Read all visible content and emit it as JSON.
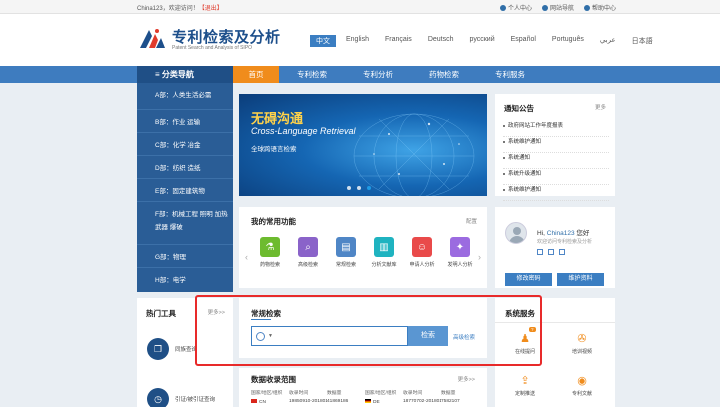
{
  "topbar": {
    "welcome": "China123，欢迎访问！",
    "logout": "【退出】",
    "links": [
      "个人中心",
      "网站导航",
      "帮助中心"
    ]
  },
  "header": {
    "title": "专利检索及分析",
    "subtitle": "Patent Search and Analysis of SIPO",
    "languages": [
      "中文",
      "English",
      "Français",
      "Deutsch",
      "русский",
      "Español",
      "Português",
      "عربي",
      "日本語"
    ],
    "active_language": "中文"
  },
  "nav": {
    "category_label": "≡  分类导航",
    "items": [
      "首页",
      "专利检索",
      "专利分析",
      "药物检索",
      "专利服务"
    ]
  },
  "categories": [
    "A部：人类生活必需",
    "B部：作业 运输",
    "C部：化学 冶金",
    "D部：纺织 造纸",
    "E部：固定建筑物",
    "F部：机械工程 照明 加热 武器 爆破",
    "G部：物理",
    "H部：电学"
  ],
  "banner": {
    "title": "无碍沟通",
    "subtitle": "Cross-Language Retrieval",
    "caption": "全球跨语言检索"
  },
  "notice": {
    "title": "通知公告",
    "more": "更多",
    "items": [
      "政府网站工作年度报表",
      "系统维护通知",
      "系统通知",
      "系统升级通知",
      "系统维护通知"
    ]
  },
  "functions": {
    "title": "我的常用功能",
    "config": "配置",
    "items": [
      {
        "label": "药物检索",
        "icon": "flask-icon",
        "color": "#6dbb2f"
      },
      {
        "label": "高级检索",
        "icon": "magnifier-icon",
        "color": "#8a63c9"
      },
      {
        "label": "常规检索",
        "icon": "document-search-icon",
        "color": "#4f86c6"
      },
      {
        "label": "分析文献库",
        "icon": "book-icon",
        "color": "#1fb3c0"
      },
      {
        "label": "申请人分析",
        "icon": "person-icon",
        "color": "#e94a4a"
      },
      {
        "label": "发明人分析",
        "icon": "bulb-icon",
        "color": "#9b6be0"
      }
    ]
  },
  "user": {
    "greeting": "Hi,",
    "name": "China123",
    "suffix": "您好",
    "sub": "欢迎访问专利检索及分析",
    "btn_password": "修改密码",
    "btn_profile": "维护资料"
  },
  "tools": {
    "title": "热门工具",
    "more": "更多>>",
    "items": [
      {
        "label": "同族查询",
        "icon": "copy-icon"
      },
      {
        "label": "引证/被引证查询",
        "icon": "clock-icon"
      }
    ]
  },
  "search": {
    "title": "常规检索",
    "placeholder": "",
    "button": "检索",
    "advanced": "高级检索"
  },
  "range": {
    "title": "数据收录范围",
    "more": "更多>>",
    "headers": [
      "国家/地区/组织",
      "收录时间",
      "数据量",
      "国家/地区/组织",
      "收录时间",
      "数据量"
    ],
    "row": [
      "CN",
      "19850910-20180106",
      "41869186",
      "DE",
      "18770702-20180115",
      "7582107"
    ]
  },
  "services": {
    "title": "系统服务",
    "items": [
      {
        "label": "在线提问",
        "icon": "user-question-icon"
      },
      {
        "label": "培训视频",
        "icon": "film-reel-icon"
      },
      {
        "label": "定制推送",
        "icon": "push-icon"
      },
      {
        "label": "专利文献",
        "icon": "eye-icon"
      }
    ],
    "badge": "?"
  },
  "colors": {
    "brand": "#1d4f8b",
    "nav": "#3e7cbf",
    "nav_active": "#f08c1c",
    "highlight": "#e82a2a"
  }
}
